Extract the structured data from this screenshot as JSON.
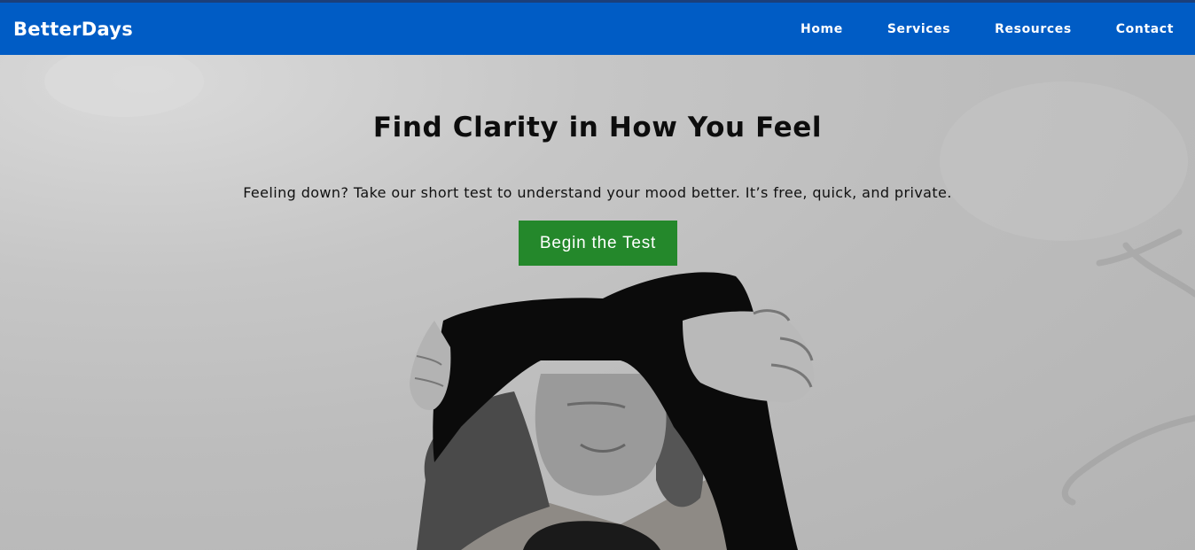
{
  "nav": {
    "brand": "BetterDays",
    "links": [
      "Home",
      "Services",
      "Resources",
      "Contact"
    ]
  },
  "hero": {
    "title": "Find Clarity in How You Feel",
    "subtitle": "Feeling down? Take our short test to understand your mood better. It’s free, quick, and private.",
    "cta_label": "Begin the Test"
  },
  "colors": {
    "nav_bg": "#005cc5",
    "cta_bg": "#24882b"
  }
}
